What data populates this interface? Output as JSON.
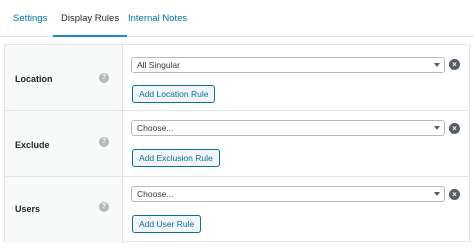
{
  "tabs": [
    {
      "label": "Settings"
    },
    {
      "label": "Display Rules"
    },
    {
      "label": "Internal Notes"
    }
  ],
  "rows": {
    "location": {
      "label": "Location",
      "help": "?",
      "select_value": "All Singular",
      "button": "Add Location Rule"
    },
    "exclude": {
      "label": "Exclude",
      "help": "?",
      "select_value": "Choose...",
      "button": "Add Exclusion Rule"
    },
    "users": {
      "label": "Users",
      "help": "?",
      "select_value": "Choose...",
      "button": "Add User Rule"
    }
  },
  "icons": {
    "remove": "close-circle-icon",
    "help": "question-circle-icon",
    "caret": "chevron-down-icon"
  },
  "colors": {
    "link": "#0073aa",
    "active_underline": "#1e8cbe",
    "button_border": "#0071a1",
    "label_bg": "#f8f9f9"
  }
}
